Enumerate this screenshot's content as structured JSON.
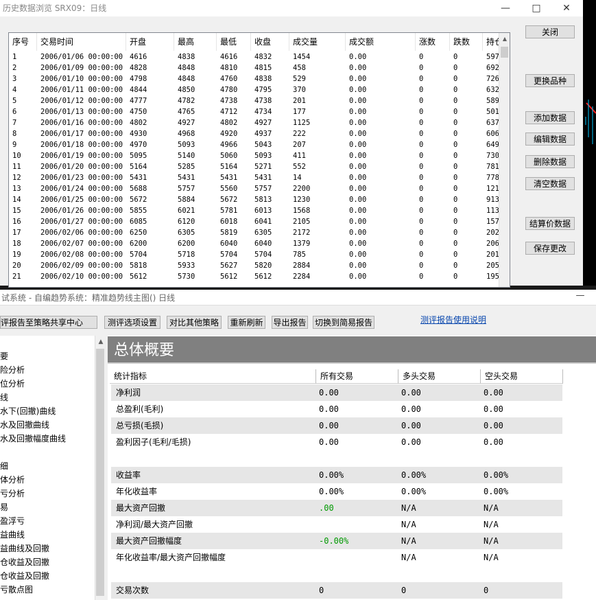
{
  "top_window": {
    "title": "历史数据浏览 SRX09：日线",
    "columns": [
      "序号",
      "交易时间",
      "开盘",
      "最高",
      "最低",
      "收盘",
      "成交量",
      "成交额",
      "涨数",
      "跌数",
      "持仓"
    ],
    "rows": [
      [
        "1",
        "2006/01/06 00:00:00",
        "4616",
        "4838",
        "4616",
        "4832",
        "1454",
        "0.00",
        "0",
        "0",
        "597"
      ],
      [
        "2",
        "2006/01/09 00:00:00",
        "4828",
        "4848",
        "4810",
        "4815",
        "458",
        "0.00",
        "0",
        "0",
        "692"
      ],
      [
        "3",
        "2006/01/10 00:00:00",
        "4798",
        "4848",
        "4760",
        "4838",
        "529",
        "0.00",
        "0",
        "0",
        "726"
      ],
      [
        "4",
        "2006/01/11 00:00:00",
        "4844",
        "4850",
        "4780",
        "4795",
        "370",
        "0.00",
        "0",
        "0",
        "632"
      ],
      [
        "5",
        "2006/01/12 00:00:00",
        "4777",
        "4782",
        "4738",
        "4738",
        "201",
        "0.00",
        "0",
        "0",
        "589"
      ],
      [
        "6",
        "2006/01/13 00:00:00",
        "4750",
        "4765",
        "4712",
        "4734",
        "177",
        "0.00",
        "0",
        "0",
        "501"
      ],
      [
        "7",
        "2006/01/16 00:00:00",
        "4802",
        "4927",
        "4802",
        "4927",
        "1125",
        "0.00",
        "0",
        "0",
        "637"
      ],
      [
        "8",
        "2006/01/17 00:00:00",
        "4930",
        "4968",
        "4920",
        "4937",
        "222",
        "0.00",
        "0",
        "0",
        "606"
      ],
      [
        "9",
        "2006/01/18 00:00:00",
        "4970",
        "5093",
        "4966",
        "5043",
        "207",
        "0.00",
        "0",
        "0",
        "649"
      ],
      [
        "10",
        "2006/01/19 00:00:00",
        "5095",
        "5140",
        "5060",
        "5093",
        "411",
        "0.00",
        "0",
        "0",
        "730"
      ],
      [
        "11",
        "2006/01/20 00:00:00",
        "5164",
        "5285",
        "5164",
        "5271",
        "552",
        "0.00",
        "0",
        "0",
        "781"
      ],
      [
        "12",
        "2006/01/23 00:00:00",
        "5431",
        "5431",
        "5431",
        "5431",
        "14",
        "0.00",
        "0",
        "0",
        "778"
      ],
      [
        "13",
        "2006/01/24 00:00:00",
        "5688",
        "5757",
        "5560",
        "5757",
        "2200",
        "0.00",
        "0",
        "0",
        "121"
      ],
      [
        "14",
        "2006/01/25 00:00:00",
        "5672",
        "5884",
        "5672",
        "5813",
        "1230",
        "0.00",
        "0",
        "0",
        "913"
      ],
      [
        "15",
        "2006/01/26 00:00:00",
        "5855",
        "6021",
        "5781",
        "6013",
        "1568",
        "0.00",
        "0",
        "0",
        "113"
      ],
      [
        "16",
        "2006/01/27 00:00:00",
        "6085",
        "6120",
        "6018",
        "6041",
        "2105",
        "0.00",
        "0",
        "0",
        "157"
      ],
      [
        "17",
        "2006/02/06 00:00:00",
        "6250",
        "6305",
        "5819",
        "6305",
        "2172",
        "0.00",
        "0",
        "0",
        "202"
      ],
      [
        "18",
        "2006/02/07 00:00:00",
        "6200",
        "6200",
        "6040",
        "6040",
        "1379",
        "0.00",
        "0",
        "0",
        "206"
      ],
      [
        "19",
        "2006/02/08 00:00:00",
        "5704",
        "5718",
        "5704",
        "5704",
        "785",
        "0.00",
        "0",
        "0",
        "201"
      ],
      [
        "20",
        "2006/02/09 00:00:00",
        "5818",
        "5933",
        "5627",
        "5820",
        "2884",
        "0.00",
        "0",
        "0",
        "205"
      ],
      [
        "21",
        "2006/02/10 00:00:00",
        "5612",
        "5730",
        "5612",
        "5612",
        "2284",
        "0.00",
        "0",
        "0",
        "195"
      ]
    ],
    "buttons": {
      "close": "关闭",
      "change_symbol": "更换品种",
      "add_data": "添加数据",
      "edit_data": "编辑数据",
      "delete_data": "删除数据",
      "clear_data": "清空数据",
      "settlement_data": "结算价数据",
      "save_changes": "保存更改"
    }
  },
  "bottom_window": {
    "title": "试系统 - 自编趋势系统：精准趋势线主图() 日线",
    "toolbar": {
      "share": "评报告至策略共享中心",
      "options": "测评选项设置",
      "compare": "对比其他策略",
      "refresh": "重新刷新",
      "export": "导出报告",
      "simple": "切换到简易报告"
    },
    "help_link": "测评报告使用说明",
    "tree": [
      "要",
      "险分析",
      "位分析",
      "线",
      "水下(回撤)曲线",
      "水及回撤曲线",
      "水及回撤幅度曲线",
      "",
      "细",
      "体分析",
      "亏分析",
      "易",
      "盈浮亏",
      "益曲线",
      "益曲线及回撤",
      "仓收益及回撤",
      "仓收益及回撤",
      "亏散点图"
    ],
    "report": {
      "section_title": "总体概要",
      "columns": [
        "统计指标",
        "所有交易",
        "多头交易",
        "空头交易"
      ],
      "rows": [
        {
          "label": "净利润",
          "all": "0.00",
          "long": "0.00",
          "short": "0.00",
          "shade": true
        },
        {
          "label": "总盈利(毛利)",
          "all": "0.00",
          "long": "0.00",
          "short": "0.00",
          "shade": false
        },
        {
          "label": "总亏损(毛损)",
          "all": "0.00",
          "long": "0.00",
          "short": "0.00",
          "shade": true
        },
        {
          "label": "盈利因子(毛利/毛损)",
          "all": "0.00",
          "long": "0.00",
          "short": "0.00",
          "shade": false
        },
        {
          "label": "",
          "all": "",
          "long": "",
          "short": "",
          "shade": false
        },
        {
          "label": "收益率",
          "all": "0.00%",
          "long": "0.00%",
          "short": "0.00%",
          "shade": true
        },
        {
          "label": "年化收益率",
          "all": "0.00%",
          "long": "0.00%",
          "short": "0.00%",
          "shade": false
        },
        {
          "label": "最大资产回撤",
          "all": ".00",
          "long": "N/A",
          "short": "N/A",
          "shade": true,
          "green": true
        },
        {
          "label": "净利润/最大资产回撤",
          "all": "",
          "long": "N/A",
          "short": "N/A",
          "shade": false
        },
        {
          "label": "最大资产回撤幅度",
          "all": "-0.00%",
          "long": "N/A",
          "short": "N/A",
          "shade": true,
          "green": true
        },
        {
          "label": "年化收益率/最大资产回撤幅度",
          "all": "",
          "long": "N/A",
          "short": "N/A",
          "shade": false
        },
        {
          "label": "",
          "all": "",
          "long": "",
          "short": "",
          "shade": false
        },
        {
          "label": "交易次数",
          "all": "0",
          "long": "0",
          "short": "0",
          "shade": true
        }
      ]
    }
  },
  "colors": {
    "shade": "#e6e6e6",
    "green": "#009900",
    "link": "#0645ad"
  }
}
